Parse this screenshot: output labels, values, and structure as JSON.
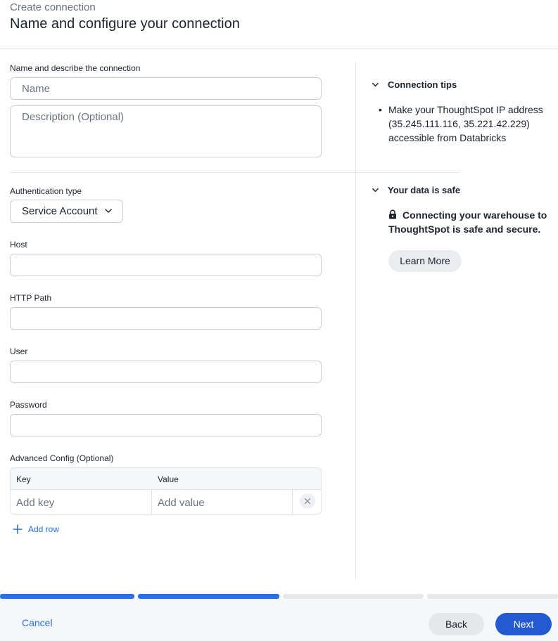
{
  "header": {
    "subtitle": "Create connection",
    "title": "Name and configure your connection"
  },
  "form": {
    "name_section_label": "Name and describe the connection",
    "name_placeholder": "Name",
    "description_placeholder": "Description (Optional)",
    "auth_type_label": "Authentication type",
    "auth_type_value": "Service Account",
    "host_label": "Host",
    "host_value": "",
    "http_path_label": "HTTP Path",
    "http_path_value": "",
    "user_label": "User",
    "user_value": "",
    "password_label": "Password",
    "password_value": "",
    "advanced_label": "Advanced Config (Optional)",
    "advanced_table": {
      "columns": [
        "Key",
        "Value"
      ],
      "key_placeholder": "Add key",
      "value_placeholder": "Add value"
    },
    "add_row_label": "Add row"
  },
  "tips": {
    "connection_tips_title": "Connection tips",
    "connection_tips_items": [
      "Make your ThoughtSpot IP address (35.245.111.116, 35.221.42.229) accessible from Databricks"
    ],
    "data_safe_title": "Your data is safe",
    "data_safe_text": "Connecting your warehouse to ThoughtSpot is safe and secure.",
    "learn_more_label": "Learn More"
  },
  "progress": {
    "total_steps": 4,
    "completed_steps": 2
  },
  "footer": {
    "cancel_label": "Cancel",
    "back_label": "Back",
    "next_label": "Next"
  },
  "colors": {
    "accent": "#2770ef",
    "primary_button": "#2359d1",
    "progress_done": "#2770ef",
    "progress_todo": "#e5e7eb"
  },
  "icons": {
    "section_toggle": "chevron-down-icon",
    "dropdown": "chevron-down-icon",
    "delete_row": "close-icon",
    "add_row": "plus-icon",
    "data_safe": "lock-icon"
  }
}
